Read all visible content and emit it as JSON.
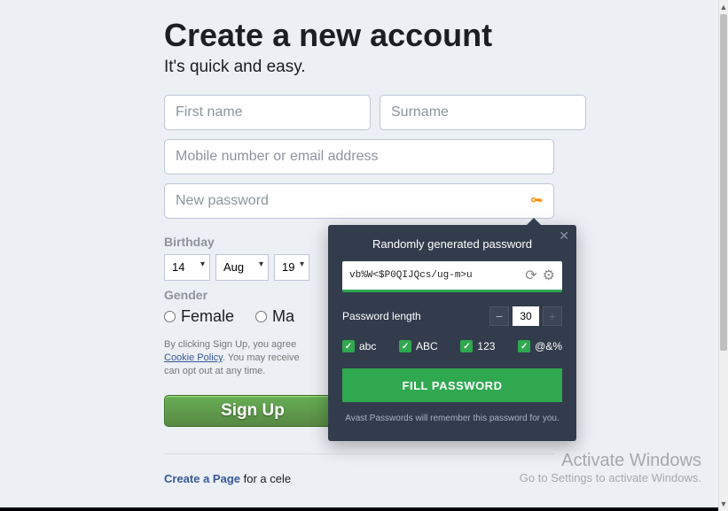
{
  "header": {
    "title": "Create a new account",
    "subtitle": "It's quick and easy."
  },
  "form": {
    "first_name_ph": "First name",
    "surname_ph": "Surname",
    "contact_ph": "Mobile number or email address",
    "password_ph": "New password",
    "birthday_label": "Birthday",
    "day": "14",
    "month": "Aug",
    "year": "19",
    "gender_label": "Gender",
    "female": "Female",
    "male": "Ma",
    "legal_1": "By clicking Sign Up, you agree",
    "legal_link": "Cookie Policy",
    "legal_2": ". You may receive",
    "legal_3": "can opt out at any time.",
    "signup": "Sign Up",
    "create_page_link": "Create a Page",
    "create_page_rest": " for a cele"
  },
  "avast": {
    "title": "Randomly generated password",
    "password": "vb%W<$P0QIJQcs/ug-m>u",
    "length_label": "Password length",
    "length_value": "30",
    "opt_lower": "abc",
    "opt_upper": "ABC",
    "opt_num": "123",
    "opt_sym": "@&%",
    "fill": "FILL PASSWORD",
    "remember": "Avast Passwords will remember this password for you."
  },
  "watermark": {
    "line1": "Activate Windows",
    "line2": "Go to Settings to activate Windows."
  }
}
